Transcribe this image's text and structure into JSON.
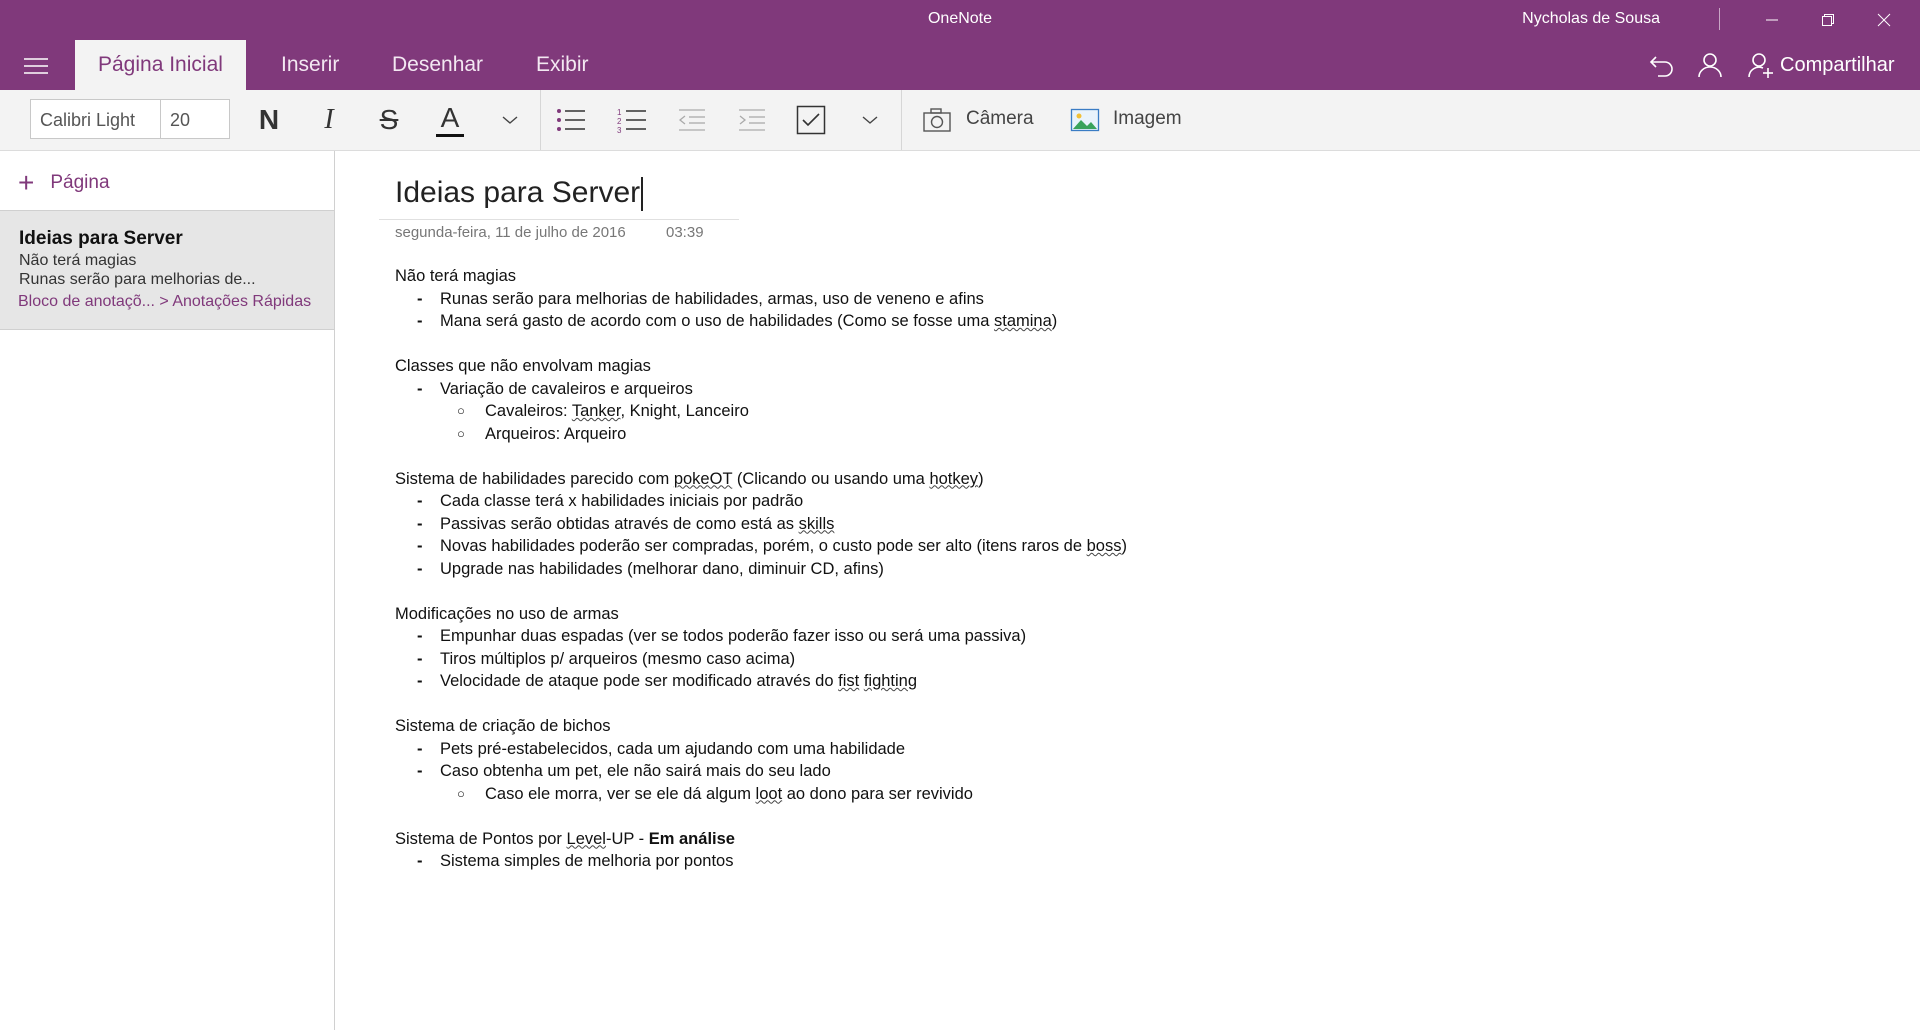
{
  "window": {
    "app_title": "OneNote",
    "user_name": "Nycholas de Sousa"
  },
  "tabs": {
    "home": "Página Inicial",
    "insert": "Inserir",
    "draw": "Desenhar",
    "view": "Exibir"
  },
  "toolbar": {
    "share_label": "Compartilhar",
    "font_name": "Calibri Light",
    "font_size": "20",
    "bold_glyph": "N",
    "italic_glyph": "I",
    "strike_glyph": "S",
    "color_glyph": "A",
    "camera_label": "Câmera",
    "image_label": "Imagem",
    "accent_color": "#80397b",
    "font_color_bar": "#111111"
  },
  "sidebar": {
    "add_page_label": "Página",
    "page": {
      "title": "Ideias para Server",
      "preview_line1": "Não terá magias",
      "preview_line2": "Runas serão para melhorias de...",
      "breadcrumb": "Bloco de anotaçõ...  >  Anotações Rápidas"
    }
  },
  "note": {
    "title": "Ideias para Server",
    "date": "segunda-feira, 11 de julho de 2016",
    "time": "03:39",
    "s1": {
      "heading": "Não terá magias",
      "i1": "Runas serão para melhorias de habilidades, armas, uso de veneno e afins",
      "i2a": "Mana será gasto de acordo com o uso de habilidades (Como se fosse uma ",
      "i2b": "stamina",
      "i2c": ")"
    },
    "s2": {
      "heading": "Classes que não envolvam magias",
      "i1": "Variação de cavaleiros e arqueiros",
      "i1a_a": "Cavaleiros: ",
      "i1a_b": "Tanker",
      "i1a_c": ", Knight, Lanceiro",
      "i1b": "Arqueiros: Arqueiro"
    },
    "s3": {
      "heading_a": "Sistema de habilidades parecido com ",
      "heading_b": "pokeOT",
      "heading_c": " (Clicando ou usando uma ",
      "heading_d": "hotkey",
      "heading_e": ")",
      "i1": "Cada classe terá x habilidades iniciais por padrão",
      "i2a": "Passivas serão obtidas através de como está as ",
      "i2b": "skills",
      "i3a": "Novas habilidades poderão ser compradas, porém, o custo pode ser alto (itens raros de ",
      "i3b": "boss",
      "i3c": ")",
      "i4": "Upgrade nas habilidades (melhorar dano, diminuir CD, afins)"
    },
    "s4": {
      "heading": "Modificações no uso de armas",
      "i1": "Empunhar duas espadas  (ver se todos poderão fazer isso ou será uma passiva)",
      "i2": "Tiros múltiplos p/ arqueiros (mesmo caso acima)",
      "i3a": "Velocidade de ataque pode ser modificado através do ",
      "i3b": "fist",
      "i3c": " ",
      "i3d": "fighting"
    },
    "s5": {
      "heading": "Sistema de criação de bichos",
      "i1": "Pets pré-estabelecidos, cada um ajudando com uma habilidade",
      "i2": "Caso obtenha um pet, ele não sairá mais do seu lado",
      "i2a_a": "Caso ele morra, ver se ele dá algum ",
      "i2a_b": "loot",
      "i2a_c": " ao dono para ser revivido"
    },
    "s6": {
      "heading_a": "Sistema de Pontos por ",
      "heading_b": "Level",
      "heading_c": "-UP - ",
      "heading_d": "Em análise",
      "i1": "Sistema simples de melhoria por pontos"
    }
  }
}
